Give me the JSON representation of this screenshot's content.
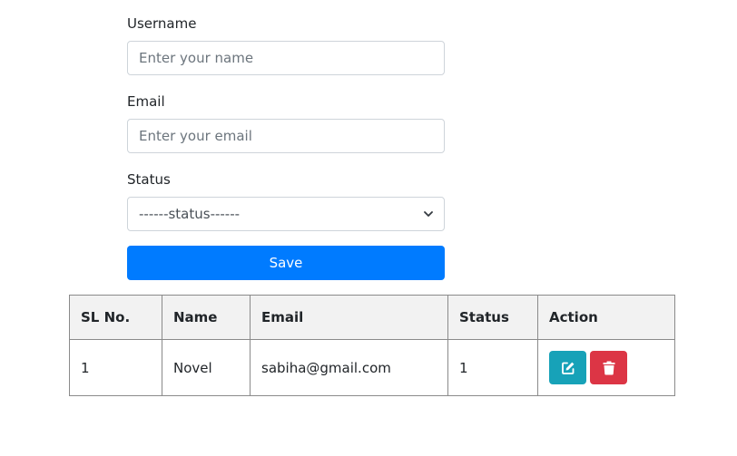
{
  "form": {
    "username_label": "Username",
    "username_placeholder": "Enter your name",
    "email_label": "Email",
    "email_placeholder": "Enter your email",
    "status_label": "Status",
    "status_selected": "------status------",
    "save_label": "Save"
  },
  "table": {
    "headers": [
      "SL No.",
      "Name",
      "Email",
      "Status",
      "Action"
    ],
    "rows": [
      {
        "sl": "1",
        "name": "Novel",
        "email": "sabiha@gmail.com",
        "status": "1"
      }
    ],
    "edit_icon": "edit-icon",
    "delete_icon": "trash-icon"
  },
  "colors": {
    "primary": "#007bff",
    "edit": "#17a2b8",
    "delete": "#dc3545",
    "header_bg": "#f2f2f2"
  }
}
